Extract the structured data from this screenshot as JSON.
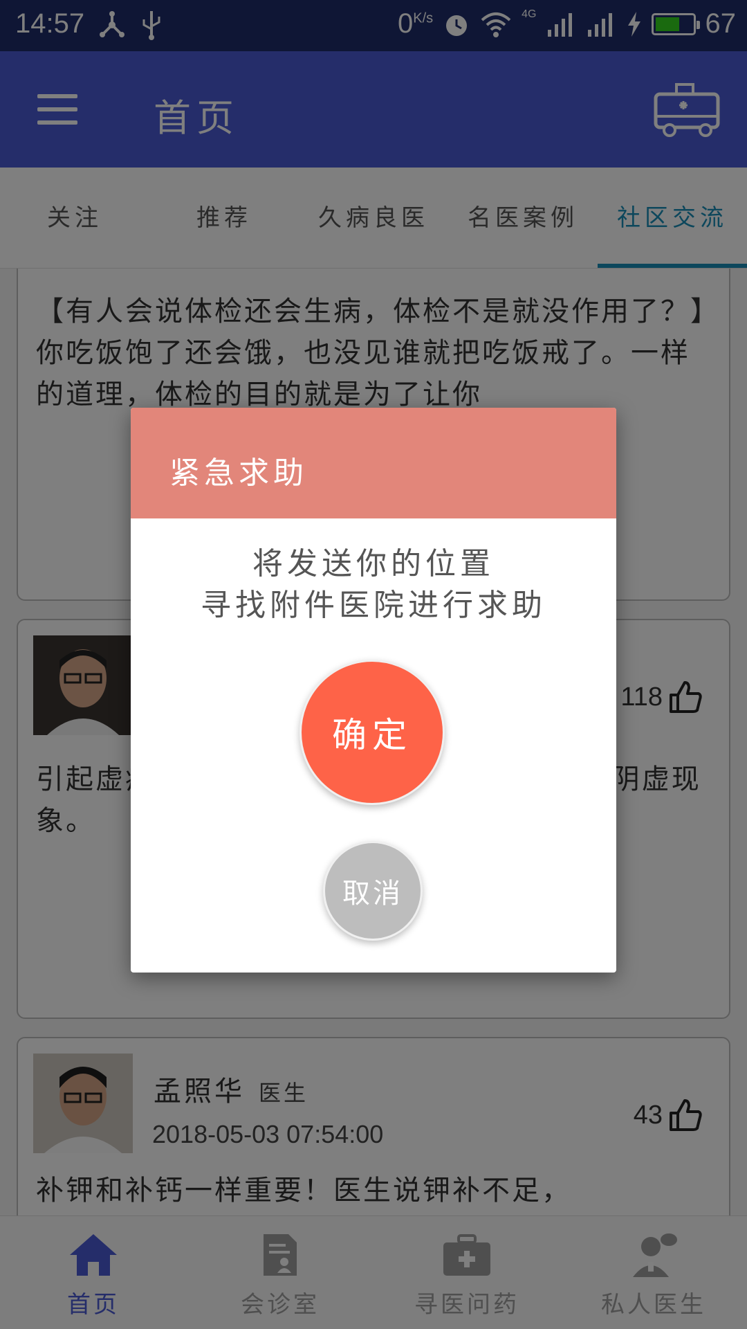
{
  "status_bar": {
    "time": "14:57",
    "net_speed_value": "0",
    "net_speed_unit": "K/s",
    "network_type": "4G",
    "battery_percent": "67",
    "battery_level": 0.67,
    "icons": [
      "usb-tether-icon",
      "usb-icon",
      "alarm-icon",
      "wifi-icon",
      "signal-icon",
      "signal-icon",
      "charging-icon",
      "battery-icon"
    ]
  },
  "app_bar": {
    "title": "首页",
    "left_icon": "menu-icon",
    "right_icon": "ambulance-icon"
  },
  "tabs": [
    {
      "label": "关注",
      "active": false
    },
    {
      "label": "推荐",
      "active": false
    },
    {
      "label": "久病良医",
      "active": false
    },
    {
      "label": "名医案例",
      "active": false
    },
    {
      "label": "社区交流",
      "active": true
    }
  ],
  "feed": {
    "cards": [
      {
        "body": "【有人会说体检还会生病，体检不是就没作用了？】你吃饭饱了还会饿，也没见谁就把吃饭戒了。一样的道理，体检的目的就是为了让你"
      },
      {
        "likes": "118",
        "body": "引起虚疾病,补物副作疗。一成的。出现一种阴虚现象。"
      },
      {
        "name": "孟照华",
        "role": "医生",
        "date": "2018-05-03 07:54:00",
        "likes": "43",
        "body": "补钾和补钙一样重要！医生说钾补不足，"
      }
    ]
  },
  "bottom_nav": [
    {
      "label": "首页",
      "icon": "home-icon",
      "active": true
    },
    {
      "label": "会诊室",
      "icon": "consultation-room-icon",
      "active": false
    },
    {
      "label": "寻医问药",
      "icon": "medical-kit-icon",
      "active": false
    },
    {
      "label": "私人医生",
      "icon": "doctor-icon",
      "active": false
    }
  ],
  "dialog": {
    "title": "紧急求助",
    "message_line1": "将发送你的位置",
    "message_line2": "寻找附件医院进行求助",
    "confirm_label": "确定",
    "cancel_label": "取消"
  },
  "colors": {
    "status_bar": "#1e2d6a",
    "app_bar": "#4a5bd4",
    "tab_active": "#1b8fb8",
    "dialog_header": "#e2867a",
    "confirm_button": "#fe6348",
    "cancel_button": "#bdbdbd",
    "nav_active": "#4a5bd4"
  }
}
